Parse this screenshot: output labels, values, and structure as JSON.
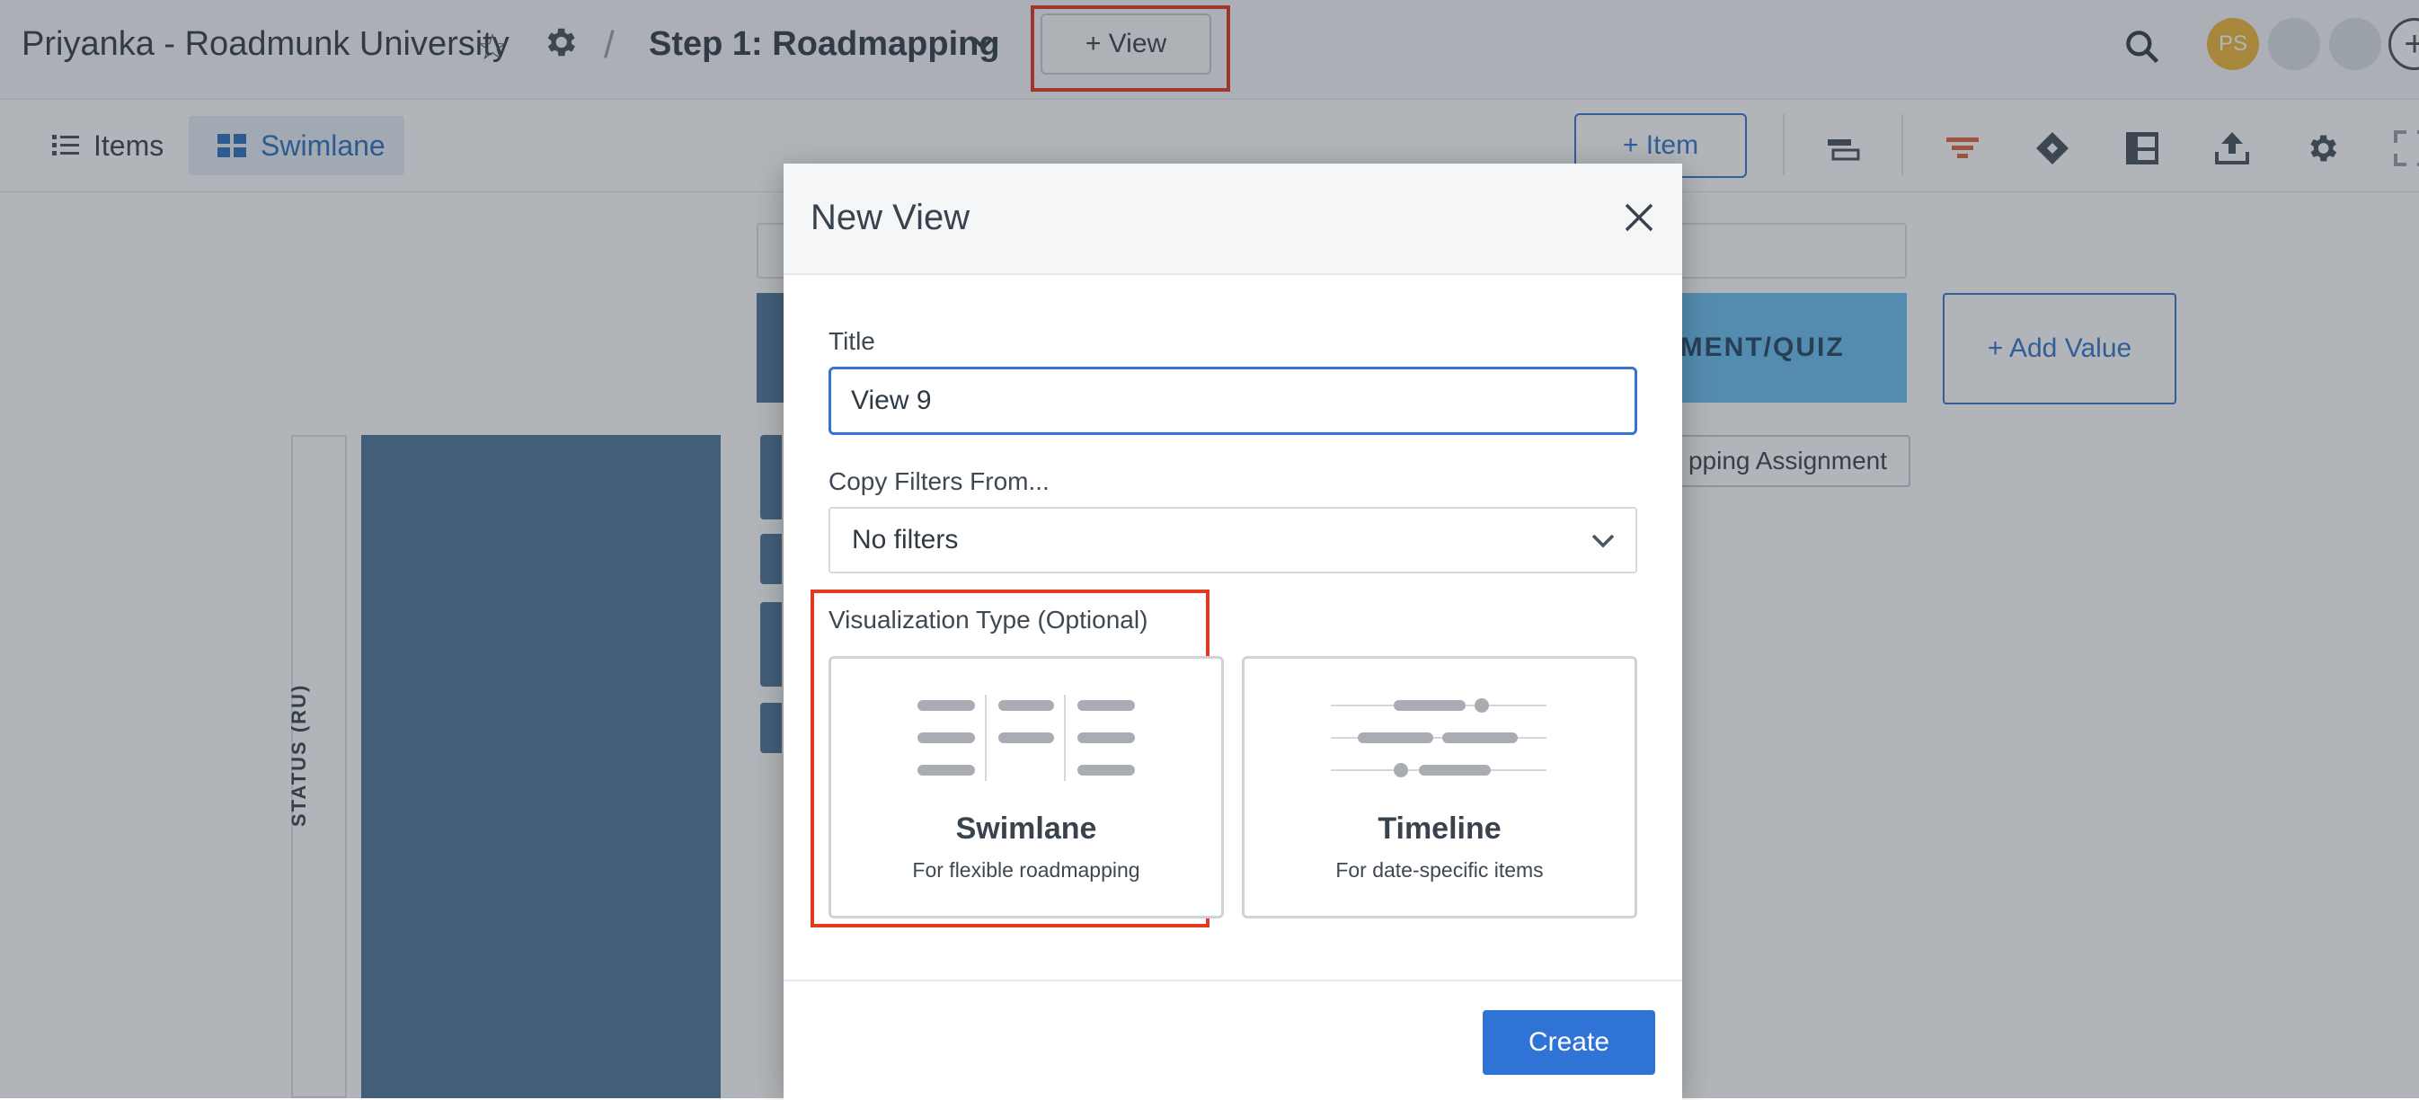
{
  "header": {
    "workspace": "Priyanka - Roadmunk University",
    "roadmap_title": "Step 1: Roadmapping",
    "add_view_label": "+ View",
    "avatar_initials": "PS",
    "add_member_label": "+"
  },
  "toolbar": {
    "tabs": [
      {
        "label": "Items",
        "icon": "list-icon"
      },
      {
        "label": "Swimlane",
        "icon": "swimlane-grid-icon",
        "active": true
      }
    ],
    "add_item_label": "+ Item",
    "icons": [
      "card-size-icon",
      "filter-icon",
      "milestone-diamond-icon",
      "layout-icon",
      "export-icon",
      "settings-gear-icon",
      "fullscreen-icon"
    ]
  },
  "board": {
    "column_header": "NMENT/QUIZ",
    "add_value_label": "+  Add Value",
    "card_text": "pping Assignment",
    "lane_label": "STATUS (RU)"
  },
  "modal": {
    "title": "New View",
    "title_label": "Title",
    "title_value": "View 9",
    "copy_filters_label": "Copy Filters From...",
    "copy_filters_value": "No filters",
    "viz_label": "Visualization Type (Optional)",
    "viz_options": [
      {
        "name": "Swimlane",
        "desc": "For flexible roadmapping"
      },
      {
        "name": "Timeline",
        "desc": "For date-specific items"
      }
    ],
    "create_label": "Create"
  },
  "colors": {
    "accent": "#2f73d6",
    "highlight": "#e33b22",
    "board_dark": "#52799b",
    "board_light": "#6ec0f1",
    "avatar": "#f0b93d"
  }
}
